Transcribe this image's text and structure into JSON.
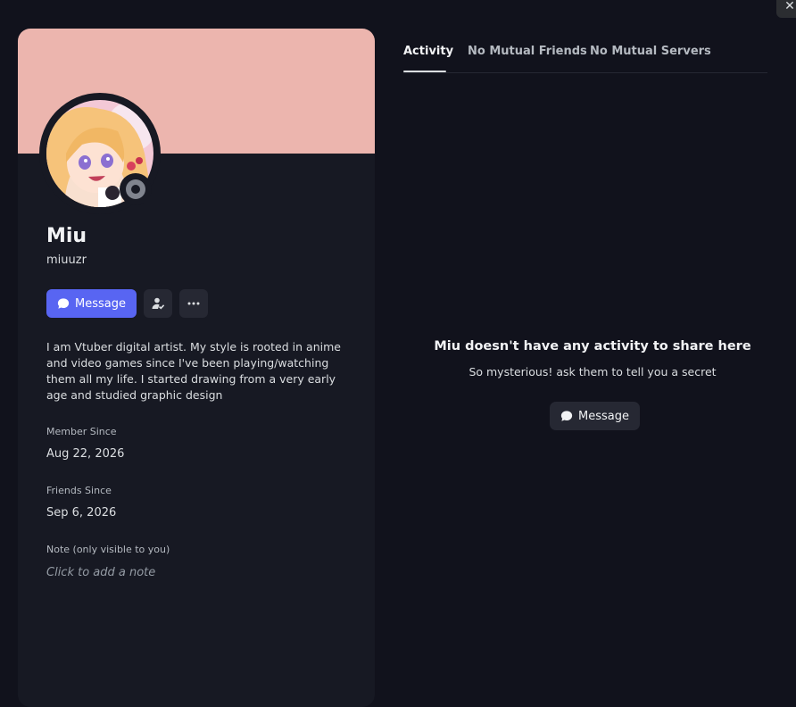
{
  "profile": {
    "display_name": "Miu",
    "username": "miuuzr",
    "banner_color": "#ecb5ae",
    "status": "offline",
    "bio": "I am Vtuber digital artist. My style is rooted in anime and video games since I've been playing/watching them all my life. I started drawing from a very early age and studied graphic design"
  },
  "actions": {
    "message_label": "Message",
    "friend_icon": "friend-check-icon",
    "more_icon": "more-dots-icon"
  },
  "sections": {
    "member_since_label": "Member Since",
    "member_since_value": "Aug 22, 2026",
    "friends_since_label": "Friends Since",
    "friends_since_value": "Sep 6, 2026",
    "note_label": "Note (only visible to you)",
    "note_placeholder": "Click to add a note"
  },
  "tabs": [
    {
      "label": "Activity",
      "active": true
    },
    {
      "label": "No Mutual Friends",
      "active": false
    },
    {
      "label": "No Mutual Servers",
      "active": false
    }
  ],
  "empty_state": {
    "title": "Miu doesn't have any activity to share here",
    "subtitle": "So mysterious! ask them to tell you a secret",
    "button_label": "Message"
  },
  "colors": {
    "accent": "#5865f2",
    "panel": "#171923",
    "background": "#11121c"
  }
}
